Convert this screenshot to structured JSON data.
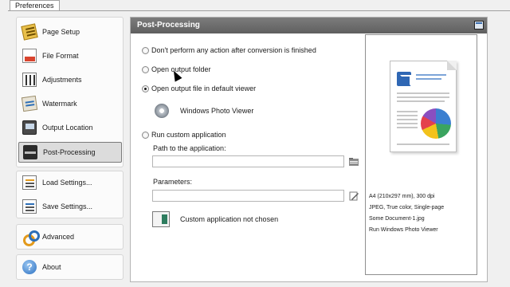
{
  "window": {
    "tab_label": "Preferences"
  },
  "sidebar": {
    "items": [
      {
        "label": "Page Setup",
        "icon": "page-setup-icon"
      },
      {
        "label": "File Format",
        "icon": "file-format-icon"
      },
      {
        "label": "Adjustments",
        "icon": "adjustments-icon"
      },
      {
        "label": "Watermark",
        "icon": "watermark-icon"
      },
      {
        "label": "Output Location",
        "icon": "output-location-icon"
      },
      {
        "label": "Post-Processing",
        "icon": "post-processing-icon",
        "selected": true
      }
    ],
    "settings": [
      {
        "label": "Load Settings...",
        "icon": "load-settings-icon"
      },
      {
        "label": "Save Settings...",
        "icon": "save-settings-icon"
      }
    ],
    "advanced": {
      "label": "Advanced",
      "icon": "gears-icon"
    },
    "about": {
      "label": "About",
      "icon": "help-icon"
    }
  },
  "panel": {
    "title": "Post-Processing",
    "options": [
      {
        "label": "Don't perform any action after conversion is finished",
        "checked": false
      },
      {
        "label": "Open output folder",
        "checked": false
      },
      {
        "label": "Open output file in default viewer",
        "checked": true
      },
      {
        "label": "Run custom application",
        "checked": false
      }
    ],
    "viewer_name": "Windows Photo Viewer",
    "path_label": "Path to the application:",
    "path_value": "",
    "params_label": "Parameters:",
    "params_value": "",
    "custom_app_status": "Custom application not chosen"
  },
  "preview": {
    "lines": [
      "A4 (210x297 mm), 300 dpi",
      "JPEG, True color, Single-page",
      "Some Document-1.jpg",
      "Run Windows Photo Viewer"
    ]
  }
}
